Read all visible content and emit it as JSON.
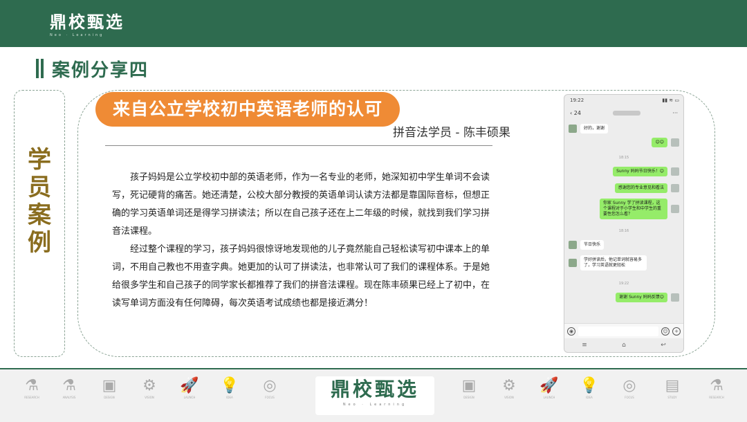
{
  "brand": {
    "name": "鼎校甄选",
    "tagline": "Neo · Learning"
  },
  "section": {
    "title": "案例分享四",
    "side_label": "学员案例"
  },
  "card": {
    "headline": "来自公立学校初中英语老师的认可",
    "byline": "拼音法学员 - 陈丰硕果",
    "paragraphs": [
      "孩子妈妈是公立学校初中部的英语老师，作为一名专业的老师，她深知初中学生单词不会读写，死记硬背的痛苦。她还清楚，公校大部分教授的英语单词认读方法都是靠国际音标，但想正确的学习英语单词还是得学习拼读法；所以在自己孩子还在上二年级的时候，就找到我们学习拼音法课程。",
      "经过整个课程的学习，孩子妈妈很惊讶地发现他的儿子竟然能自己轻松读写初中课本上的单词，不用自己教也不用查字典。她更加的认可了拼读法，也非常认可了我们的课程体系。于是她给很多学生和自己孩子的同学家长都推荐了我们的拼音法课程。现在陈丰硕果已经上了初中，在读写单词方面没有任何障碍，每次英语考试成绩也都是接近满分！"
    ]
  },
  "phone": {
    "time": "19:22",
    "status_icons": "▮▮ ≋ ▭",
    "back": "‹ 24",
    "more": "···",
    "messages": [
      {
        "side": "left",
        "text": "好的，谢谢"
      },
      {
        "side": "right",
        "text": "😊😊"
      },
      {
        "side": "time",
        "text": "18:15"
      },
      {
        "side": "right",
        "text": "Sunny 妈妈节日快乐！😊"
      },
      {
        "side": "right",
        "text": "感谢您的专业意见和看法"
      },
      {
        "side": "right",
        "text": "你家 Sunny 学了拼读课程，这个课程对于小学生和中学生的重要性您怎么看？"
      },
      {
        "side": "time",
        "text": "18:16"
      },
      {
        "side": "left",
        "text": "节日快乐"
      },
      {
        "side": "left",
        "text": "学好拼读后，他记单词就容易多了，学习英语就更轻松"
      },
      {
        "side": "time",
        "text": "19:22"
      },
      {
        "side": "right",
        "text": "谢谢 Sunny 妈妈反馈😊"
      }
    ],
    "sys_nav": [
      "≡",
      "⌂",
      "↩"
    ]
  },
  "footer": {
    "icons": [
      {
        "name": "microscope",
        "glyph": "⚗",
        "caption": "RESEARCH"
      },
      {
        "name": "flask",
        "glyph": "⚗",
        "caption": "ANALYSIS"
      },
      {
        "name": "board",
        "glyph": "▣",
        "caption": "DESIGN"
      },
      {
        "name": "gear",
        "glyph": "⚙",
        "caption": "VISION"
      },
      {
        "name": "rocket",
        "glyph": "🚀",
        "caption": "LAUNCH"
      },
      {
        "name": "bulb",
        "glyph": "💡",
        "caption": "IDEA"
      },
      {
        "name": "target",
        "glyph": "◎",
        "caption": "FOCUS"
      },
      {
        "name": "board2",
        "glyph": "▣",
        "caption": "DESIGN"
      },
      {
        "name": "gear2",
        "glyph": "⚙",
        "caption": "VISION"
      },
      {
        "name": "rocket2",
        "glyph": "🚀",
        "caption": "LAUNCH"
      },
      {
        "name": "bulb2",
        "glyph": "💡",
        "caption": "IDEA"
      },
      {
        "name": "target2",
        "glyph": "◎",
        "caption": "FOCUS"
      },
      {
        "name": "book",
        "glyph": "▤",
        "caption": "STUDY"
      },
      {
        "name": "microscope2",
        "glyph": "⚗",
        "caption": "RESEARCH"
      }
    ]
  },
  "colors": {
    "brand_green": "#2e6b4f",
    "accent_orange": "#ef8b35",
    "label_gold": "#8a6d1f",
    "chat_green": "#95ec69"
  }
}
